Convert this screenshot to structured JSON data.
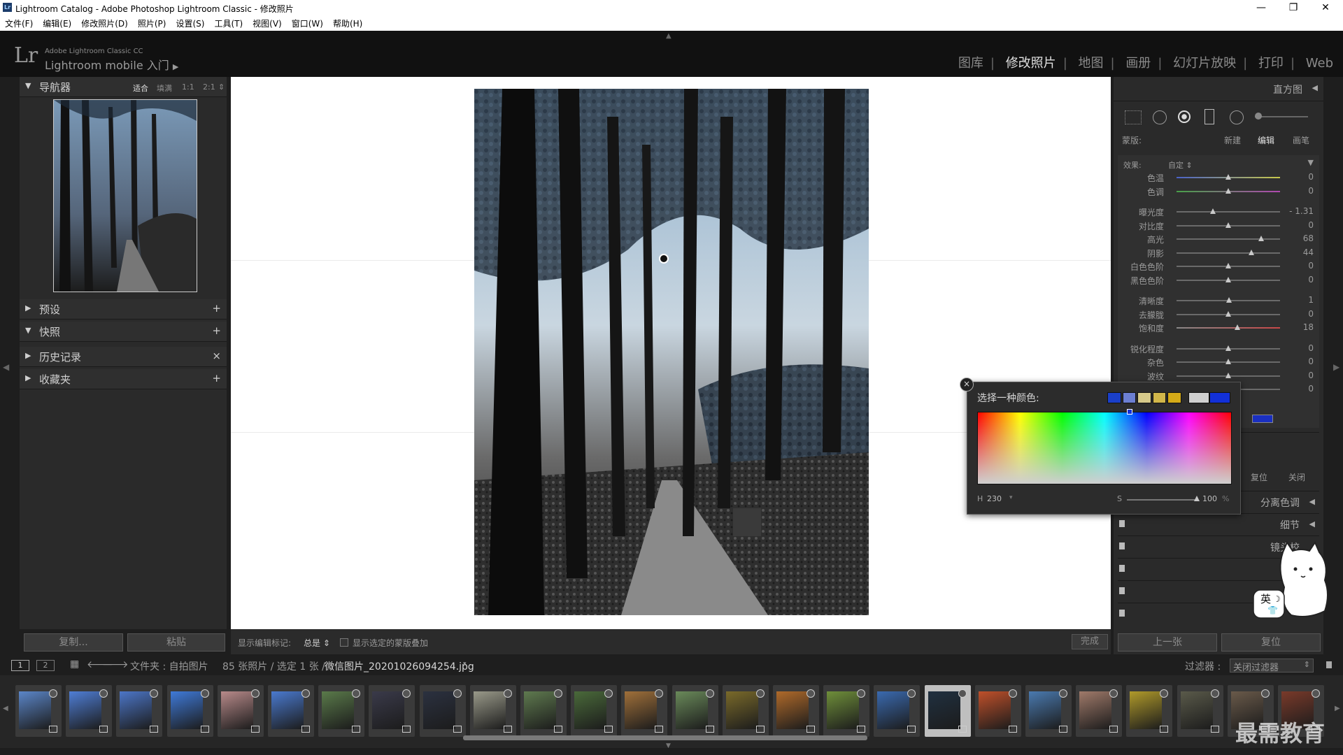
{
  "window": {
    "title": "Lightroom Catalog - Adobe Photoshop Lightroom Classic - 修改照片",
    "app_icon": "Lr",
    "controls": [
      "—",
      "❐",
      "✕"
    ]
  },
  "menu": [
    "文件(F)",
    "编辑(E)",
    "修改照片(D)",
    "照片(P)",
    "设置(S)",
    "工具(T)",
    "视图(V)",
    "窗口(W)",
    "帮助(H)"
  ],
  "header": {
    "logo": "Lr",
    "product_line1": "Adobe Lightroom Classic CC",
    "product_line2": "Lightroom mobile 入门",
    "play": "▶",
    "modules": [
      "图库",
      "修改照片",
      "地图",
      "画册",
      "幻灯片放映",
      "打印",
      "Web"
    ],
    "active_module": "修改照片"
  },
  "left_panel": {
    "navigator": {
      "label": "导航器",
      "options": [
        "适合",
        "填满",
        "1:1",
        "2:1"
      ],
      "active_option": "适合"
    },
    "sections": [
      {
        "label": "预设",
        "action": "+"
      },
      {
        "label": "快照",
        "action": "+"
      },
      {
        "label": "历史记录",
        "action": "×"
      },
      {
        "label": "收藏夹",
        "action": "+"
      }
    ],
    "copy_button": "复制...",
    "paste_button": "粘贴"
  },
  "toolbar": {
    "show_marks_label": "显示编辑标记:",
    "show_marks_value": "总是",
    "overlay_label": "显示选定的蒙版叠加",
    "done_button": "完成"
  },
  "right_panel": {
    "histogram_label": "直方图",
    "mask": {
      "label": "蒙版:",
      "new": "新建",
      "edit": "编辑",
      "brush": "画笔"
    },
    "effect": {
      "label": "效果:",
      "value": "自定"
    },
    "sliders": [
      {
        "label": "色温",
        "value": "0",
        "pos": 0.5,
        "group": 1
      },
      {
        "label": "色调",
        "value": "0",
        "pos": 0.5,
        "group": 1
      },
      {
        "label": "曝光度",
        "value": "- 1.31",
        "pos": 0.35,
        "group": 2
      },
      {
        "label": "对比度",
        "value": "0",
        "pos": 0.5,
        "group": 2
      },
      {
        "label": "高光",
        "value": "68",
        "pos": 0.82,
        "group": 2
      },
      {
        "label": "阴影",
        "value": "44",
        "pos": 0.72,
        "group": 2
      },
      {
        "label": "白色色阶",
        "value": "0",
        "pos": 0.5,
        "group": 2
      },
      {
        "label": "黑色色阶",
        "value": "0",
        "pos": 0.5,
        "group": 2
      },
      {
        "label": "清晰度",
        "value": "1",
        "pos": 0.51,
        "group": 3
      },
      {
        "label": "去朦胧",
        "value": "0",
        "pos": 0.5,
        "group": 3
      },
      {
        "label": "饱和度",
        "value": "18",
        "pos": 0.59,
        "group": 3
      },
      {
        "label": "锐化程度",
        "value": "0",
        "pos": 0.5,
        "group": 4
      },
      {
        "label": "杂色",
        "value": "0",
        "pos": 0.5,
        "group": 4
      },
      {
        "label": "波纹",
        "value": "0",
        "pos": 0.5,
        "group": 4
      },
      {
        "label": "",
        "value": "0",
        "pos": 0.5,
        "group": 4
      }
    ],
    "reset_button": "复位",
    "close_button": "关闭",
    "panels": [
      "分离色调",
      "细节",
      "镜头校",
      "变",
      "",
      ""
    ],
    "prev_button": "上一张",
    "reset_all_button": "复位"
  },
  "color_picker": {
    "title": "选择一种颜色:",
    "close": "×",
    "swatches": [
      "#1a3fc9",
      "#6c7fd2",
      "#d6c98a",
      "#d1b64a",
      "#d4aa18"
    ],
    "current_swatches": [
      "#d0d0d0",
      "#1230d8"
    ],
    "h_label": "H",
    "h_value": "230",
    "s_label": "S",
    "s_value": "100",
    "s_unit": "%",
    "saturation": 1.0
  },
  "filmstrip": {
    "view1": "1",
    "view2": "2",
    "path": "文件夹 : 自拍图片",
    "count": "85 张照片 / 选定 1 张 /",
    "filename": "微信图片_20201026094254.jpg",
    "filter_label": "过滤器 :",
    "filter_value": "关闭过滤器",
    "thumb_colors": [
      "#5b86c9",
      "#4f7ed6",
      "#4c76c8",
      "#3f7ad9",
      "#b88a8a",
      "#4a7ad0",
      "#5a7a4a",
      "#3a3a4a",
      "#2b3140",
      "#9a9a8a",
      "#5f7a4f",
      "#4a6a3a",
      "#a0703a",
      "#6a8a5a",
      "#7a6a2a",
      "#b06a2a",
      "#6f8f3a",
      "#3a6ab0",
      "#203040",
      "#c0502a",
      "#4a7ab0",
      "#a07a6a",
      "#b09a2a",
      "#5a5a4a",
      "#6a5a4a",
      "#7a3a2a"
    ],
    "selected_index": 18
  },
  "watermark": "最需教育",
  "ime_badge": "英"
}
